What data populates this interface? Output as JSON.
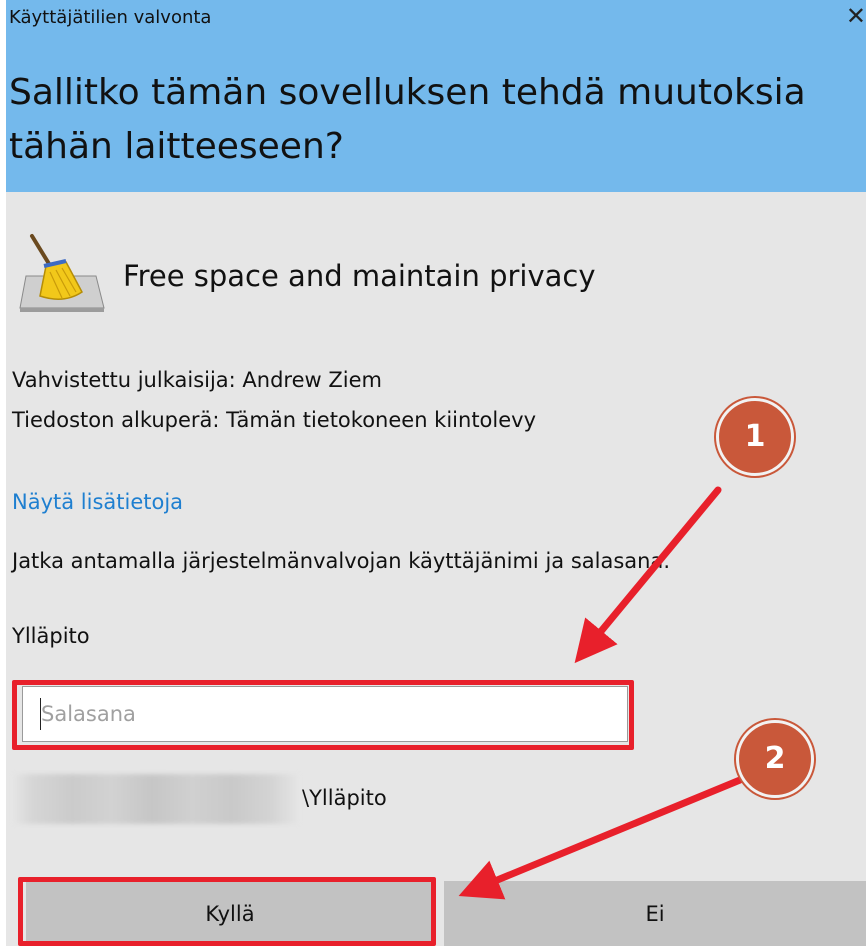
{
  "window": {
    "title": "Käyttäjätilien valvonta",
    "close_glyph": "✕"
  },
  "prompt": {
    "heading": "Sallitko tämän sovelluksen tehdä muutoksia tähän laitteeseen?"
  },
  "app": {
    "icon": "broom-icon",
    "name": "Free space and maintain privacy"
  },
  "details": {
    "publisher": "Vahvistettu julkaisija: Andrew Ziem",
    "origin": "Tiedoston alkuperä: Tämän tietokoneen kiintolevy",
    "more_info_link": "Näytä lisätietoja"
  },
  "credentials": {
    "instruction": "Jatka antamalla järjestelmänvalvojan käyttäjänimi ja salasana.",
    "account_name": "Ylläpito",
    "password_placeholder": "Salasana",
    "password_value": "",
    "domain_suffix": "\\Ylläpito"
  },
  "buttons": {
    "yes": "Kyllä",
    "no": "Ei"
  },
  "annotations": {
    "step1": "1",
    "step2": "2",
    "highlight_color": "#e8202b",
    "badge_color": "#c9583a"
  },
  "colors": {
    "header_bg": "#74b9ec",
    "dialog_bg": "#e6e6e6",
    "link": "#1e7fd0",
    "button_bg": "#c2c2c2"
  }
}
